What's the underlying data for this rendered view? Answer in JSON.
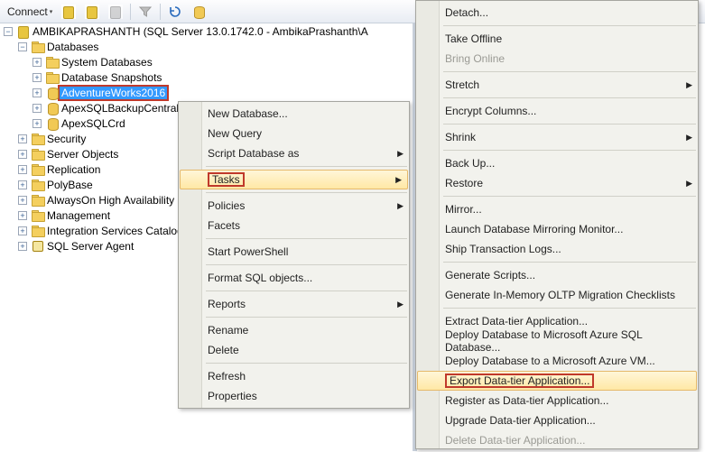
{
  "toolbar": {
    "connect_label": "Connect"
  },
  "tree": {
    "server": "AMBIKAPRASHANTH (SQL Server 13.0.1742.0 - AmbikaPrashanth\\A",
    "databases": "Databases",
    "sys_db": "System Databases",
    "snapshots": "Database Snapshots",
    "adventure": "AdventureWorks2016",
    "backup": "ApexSQLBackupCentral",
    "crd": "ApexSQLCrd",
    "security": "Security",
    "server_obj": "Server Objects",
    "replication": "Replication",
    "polybase": "PolyBase",
    "alwayson": "AlwaysOn High Availability",
    "management": "Management",
    "isc": "Integration Services Catalogs",
    "agent": "SQL Server Agent"
  },
  "menu1": {
    "new_db": "New Database...",
    "new_query": "New Query",
    "script_db": "Script Database as",
    "tasks": "Tasks",
    "policies": "Policies",
    "facets": "Facets",
    "start_ps": "Start PowerShell",
    "format_sql": "Format SQL objects...",
    "reports": "Reports",
    "rename": "Rename",
    "delete": "Delete",
    "refresh": "Refresh",
    "properties": "Properties"
  },
  "menu2": {
    "detach": "Detach...",
    "take_offline": "Take Offline",
    "bring_online": "Bring Online",
    "stretch": "Stretch",
    "encrypt": "Encrypt Columns...",
    "shrink": "Shrink",
    "backup": "Back Up...",
    "restore": "Restore",
    "mirror": "Mirror...",
    "launch_mirror": "Launch Database Mirroring Monitor...",
    "ship_logs": "Ship Transaction Logs...",
    "gen_scripts": "Generate Scripts...",
    "gen_oltp": "Generate In-Memory OLTP Migration Checklists",
    "extract_dta": "Extract Data-tier Application...",
    "deploy_azure_db": "Deploy Database to Microsoft Azure SQL Database...",
    "deploy_azure_vm": "Deploy Database to a Microsoft Azure VM...",
    "export_dta": "Export Data-tier Application...",
    "register_dta": "Register as Data-tier Application...",
    "upgrade_dta": "Upgrade Data-tier Application...",
    "delete_dta": "Delete Data-tier Application..."
  }
}
